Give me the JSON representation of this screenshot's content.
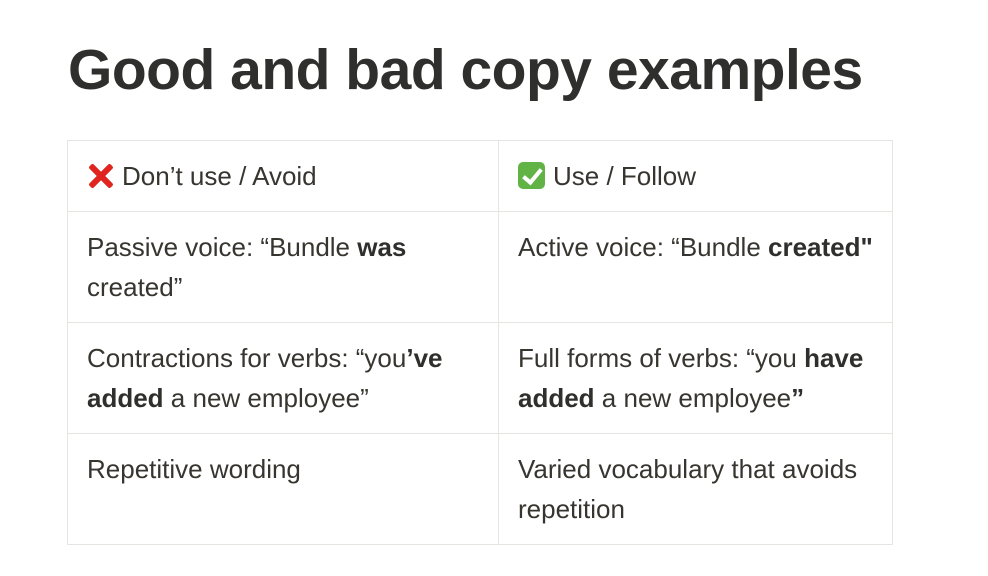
{
  "title": "Good and bad copy examples",
  "table": {
    "headers": [
      {
        "icon": "cross-mark-icon",
        "label": "Don’t use / Avoid"
      },
      {
        "icon": "check-mark-icon",
        "label": "Use / Follow"
      }
    ],
    "rows": [
      {
        "avoid": [
          {
            "text": "Passive voice: “Bundle ",
            "bold": false
          },
          {
            "text": "was",
            "bold": true
          },
          {
            "text": " created”",
            "bold": false
          }
        ],
        "follow": [
          {
            "text": "Active voice: “Bundle ",
            "bold": false
          },
          {
            "text": "created\"",
            "bold": true
          }
        ]
      },
      {
        "avoid": [
          {
            "text": "Contractions for verbs: “you",
            "bold": false
          },
          {
            "text": "’ve added",
            "bold": true
          },
          {
            "text": " a new employee”",
            "bold": false
          }
        ],
        "follow": [
          {
            "text": "Full forms of verbs: “you ",
            "bold": false
          },
          {
            "text": "have added",
            "bold": true
          },
          {
            "text": " a new employee",
            "bold": false
          },
          {
            "text": "”",
            "bold": true
          }
        ]
      },
      {
        "avoid": [
          {
            "text": "Repetitive wording",
            "bold": false
          }
        ],
        "follow": [
          {
            "text": "Varied vocabulary that avoids repetition",
            "bold": false
          }
        ]
      }
    ]
  }
}
